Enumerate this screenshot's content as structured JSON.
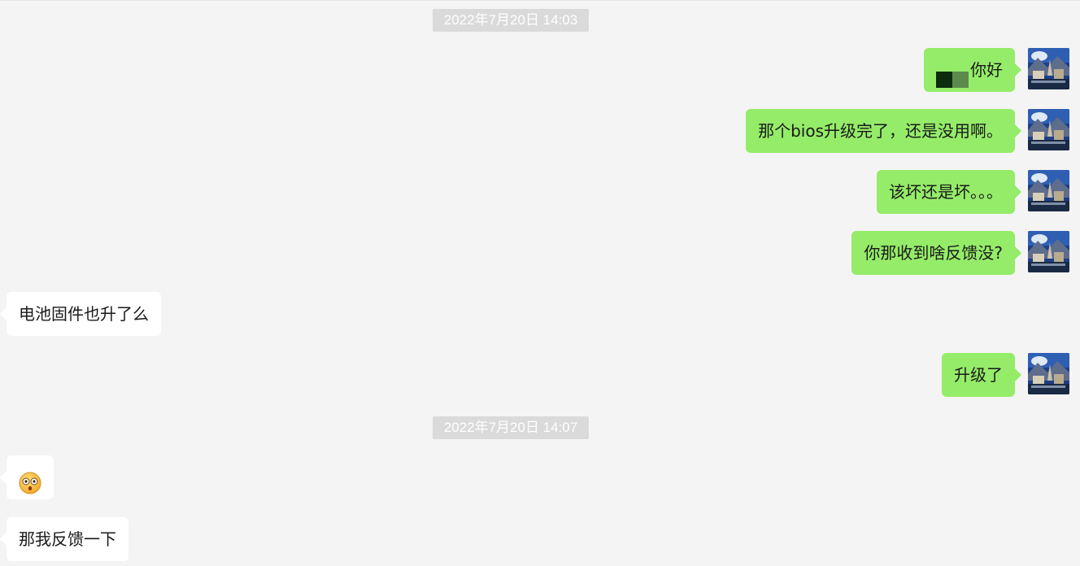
{
  "timestamps": [
    "2022年7月20日 14:03",
    "2022年7月20日 14:07"
  ],
  "messages": [
    {
      "side": "out",
      "text": "你好",
      "has_redaction": true
    },
    {
      "side": "out",
      "text": "那个bios升级完了，还是没用啊。"
    },
    {
      "side": "out",
      "text": "该坏还是坏。。。"
    },
    {
      "side": "out",
      "text": "你那收到啥反馈没?"
    },
    {
      "side": "in",
      "text": "电池固件也升了么"
    },
    {
      "side": "out",
      "text": "升级了"
    },
    {
      "side": "in",
      "emoji": "shocked-face-emoji"
    },
    {
      "side": "in",
      "text": "那我反馈一下"
    }
  ],
  "colors": {
    "background": "#f4f4f4",
    "outgoing_bubble": "#95ec69",
    "incoming_bubble": "#ffffff",
    "timestamp_bg": "#dadada",
    "timestamp_text": "#ffffff",
    "message_text": "#1a1a1a"
  },
  "avatar": {
    "icon": "landscape-avatar"
  }
}
